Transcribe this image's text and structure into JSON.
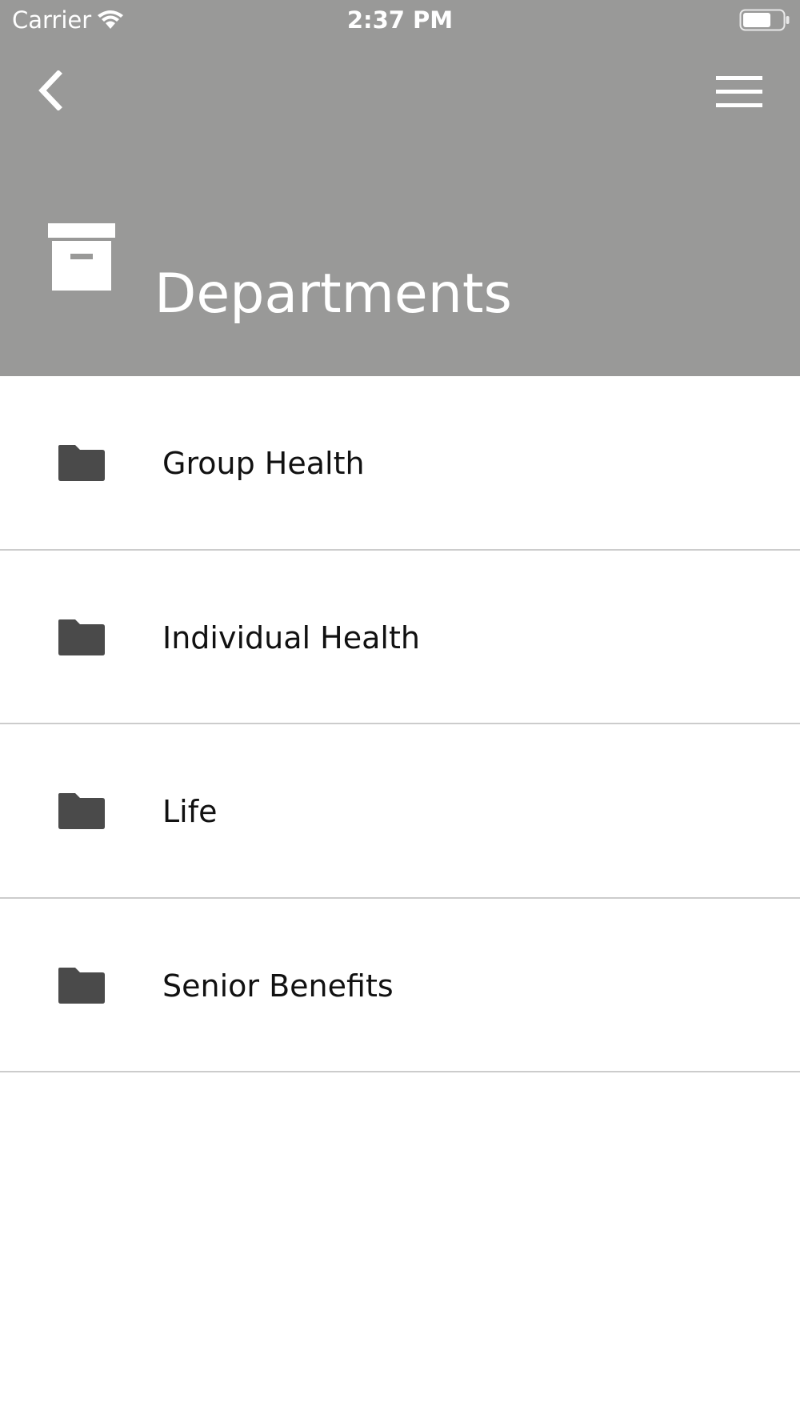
{
  "status_bar": {
    "carrier": "Carrier",
    "time": "2:37 PM",
    "wifi_icon": "wifi-icon",
    "battery_icon": "battery-icon"
  },
  "nav": {
    "back_icon": "chevron-left-icon",
    "menu_icon": "hamburger-menu-icon"
  },
  "header": {
    "icon": "archive-box-icon",
    "title": "Departments",
    "background_color": "#999998"
  },
  "departments": {
    "items": [
      {
        "label": "Group Health",
        "icon": "folder-icon"
      },
      {
        "label": "Individual Health",
        "icon": "folder-icon"
      },
      {
        "label": "Life",
        "icon": "folder-icon"
      },
      {
        "label": "Senior Benefits",
        "icon": "folder-icon"
      }
    ]
  },
  "colors": {
    "header_bg": "#999998",
    "folder_icon": "#4a4a4a",
    "divider": "#cccccc",
    "text": "#111111"
  }
}
